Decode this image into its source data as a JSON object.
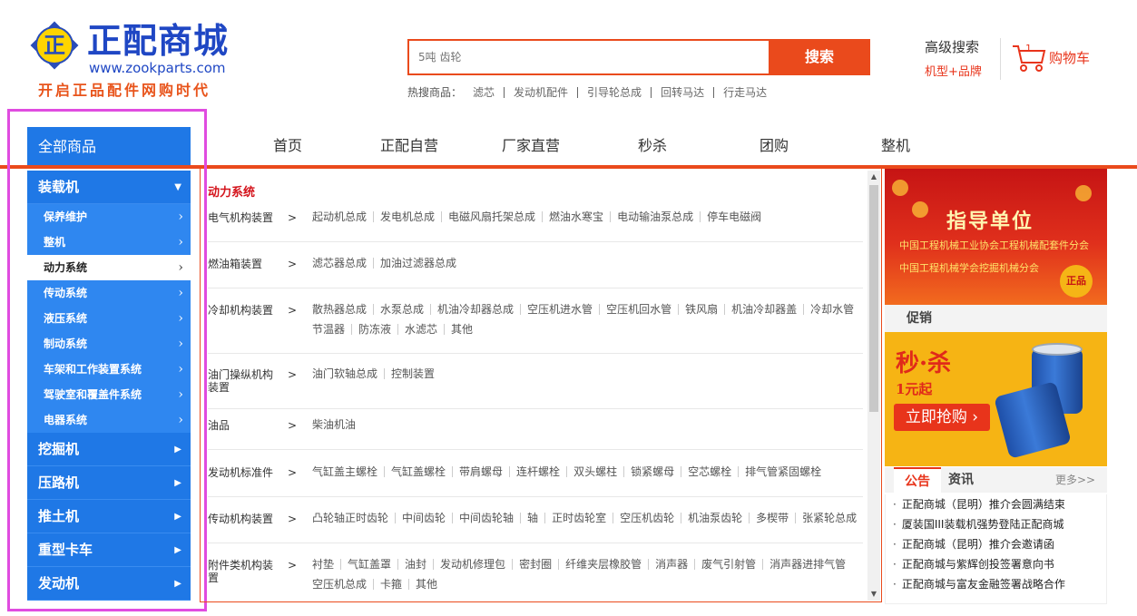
{
  "header": {
    "logo_char": "正",
    "logo_name": "正配商城",
    "logo_url": "www.zookparts.com",
    "logo_slogan": "开启正品配件网购时代",
    "search_placeholder": "5吨 齿轮",
    "search_button": "搜索",
    "hot_label": "热搜商品：",
    "hot_items": [
      "滤芯",
      "发动机配件",
      "引导轮总成",
      "回转马达",
      "行走马达"
    ],
    "advanced_search": "高级搜索",
    "advanced_sub": "机型+品牌",
    "cart_label": "购物车",
    "cart_count": "1"
  },
  "nav": {
    "all_goods": "全部商品",
    "items": [
      "首页",
      "正配自营",
      "厂家直营",
      "秒杀",
      "团购",
      "整机"
    ]
  },
  "sidebar": {
    "open_category": "装载机",
    "open_arrow": "▼",
    "sub_items": [
      "保养维护",
      "整机",
      "动力系统",
      "传动系统",
      "液压系统",
      "制动系统",
      "车架和工作装置系统",
      "驾驶室和覆盖件系统",
      "电器系统"
    ],
    "active_sub": 2,
    "categories": [
      "挖掘机",
      "压路机",
      "推土机",
      "重型卡车",
      "发动机"
    ],
    "chevron": "›",
    "closed_arrow": "▶"
  },
  "panel": {
    "title": "动力系统",
    "chevron": ">",
    "rows": [
      {
        "label": "电气机构装置",
        "items": [
          "起动机总成",
          "发电机总成",
          "电磁风扇托架总成",
          "燃油水寒宝",
          "电动输油泵总成",
          "停车电磁阀"
        ]
      },
      {
        "label": "燃油箱装置",
        "items": [
          "滤芯器总成",
          "加油过滤器总成"
        ]
      },
      {
        "label": "冷却机构装置",
        "items": [
          "散热器总成",
          "水泵总成",
          "机油冷却器总成",
          "空压机进水管",
          "空压机回水管",
          "铁风扇",
          "机油冷却器盖",
          "冷却水管",
          "节温器",
          "防冻液",
          "水滤芯",
          "其他"
        ]
      },
      {
        "label": "油门操纵机构装置",
        "items": [
          "油门软轴总成",
          "控制装置"
        ]
      },
      {
        "label": "油品",
        "items": [
          "柴油机油"
        ]
      },
      {
        "label": "发动机标准件",
        "items": [
          "气缸盖主螺栓",
          "气缸盖螺栓",
          "带肩螺母",
          "连杆螺栓",
          "双头螺柱",
          "锁紧螺母",
          "空芯螺栓",
          "排气管紧固螺栓"
        ]
      },
      {
        "label": "传动机构装置",
        "items": [
          "凸轮轴正时齿轮",
          "中间齿轮",
          "中间齿轮轴",
          "轴",
          "正时齿轮室",
          "空压机齿轮",
          "机油泵齿轮",
          "多楔带",
          "张紧轮总成"
        ]
      },
      {
        "label": "附件类机构装置",
        "items": [
          "衬垫",
          "气缸盖罩",
          "油封",
          "发动机修理包",
          "密封圈",
          "纤维夹层橡胶管",
          "消声器",
          "废气引射管",
          "消声器进排气管",
          "空压机总成",
          "卡箍",
          "其他"
        ]
      }
    ]
  },
  "right": {
    "banner1_title": "指导单位",
    "banner1_org1": "中国工程机械工业协会工程机械配套件分会",
    "banner1_org2": "中国工程机械学会挖掘机械分会",
    "banner1_seal": "正品",
    "promo_head": "促销",
    "banner2_title": "秒·杀",
    "banner2_price": "1元起",
    "banner2_button": "立即抢购 ›",
    "tab_notice": "公告",
    "tab_news": "资讯",
    "tab_more": "更多>>",
    "notices": [
      "正配商城（昆明）推介会圆满结束",
      "厦装国III装载机强势登陆正配商城",
      "正配商城（昆明）推介会邀请函",
      "正配商城与紫辉创投签署意向书",
      "正配商城与富友金融签署战略合作"
    ]
  },
  "colors": {
    "accent": "#ea4a1c",
    "sidebar_blue": "#1f78e6",
    "highlight": "#e04ce0"
  }
}
